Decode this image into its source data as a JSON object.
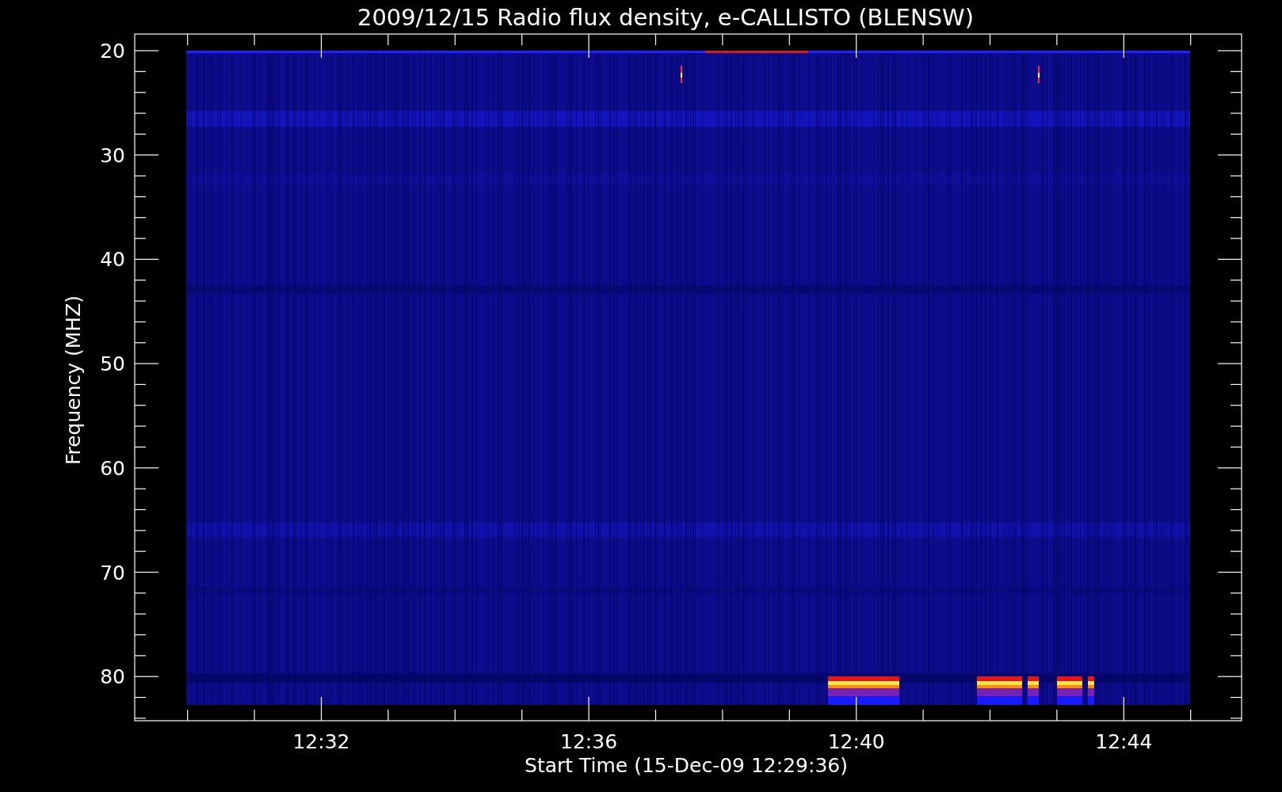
{
  "title": "2009/12/15  Radio flux density, e-CALLISTO (BLENSW)",
  "xlabel": "Start Time (15-Dec-09 12:29:36)",
  "ylabel": "Frequency (MHZ)",
  "xticks": [
    "12:32",
    "12:36",
    "12:40",
    "12:44"
  ],
  "yticks": [
    "20",
    "30",
    "40",
    "50",
    "60",
    "70",
    "80"
  ]
}
